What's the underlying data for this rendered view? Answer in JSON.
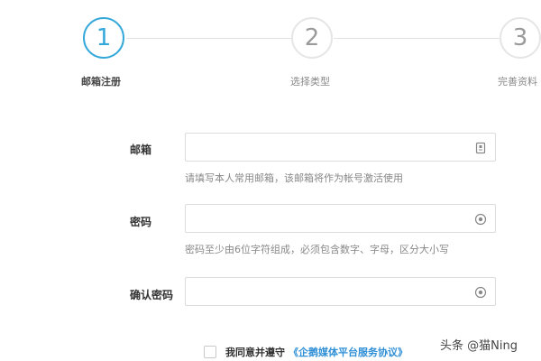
{
  "stepper": {
    "steps": [
      {
        "number": "1",
        "label": "邮箱注册"
      },
      {
        "number": "2",
        "label": "选择类型"
      },
      {
        "number": "3",
        "label": "完善资料"
      }
    ],
    "active_index": 0
  },
  "form": {
    "email": {
      "label": "邮箱",
      "value": "",
      "hint": "请填写本人常用邮箱，该邮箱将作为帐号激活使用",
      "icon": "id-card-icon"
    },
    "password": {
      "label": "密码",
      "value": "",
      "hint": "密码至少由6位字符组成，必须包含数字、字母，区分大小写",
      "icon": "eye-icon"
    },
    "confirm_password": {
      "label": "确认密码",
      "value": "",
      "icon": "eye-icon"
    }
  },
  "agreement": {
    "text": "我同意并遵守",
    "link": "《企鹅媒体平台服务协议》",
    "checked": false
  },
  "watermark": "头条 @猫Ning",
  "colors": {
    "accent": "#35a8da",
    "link": "#2f8fd6"
  }
}
